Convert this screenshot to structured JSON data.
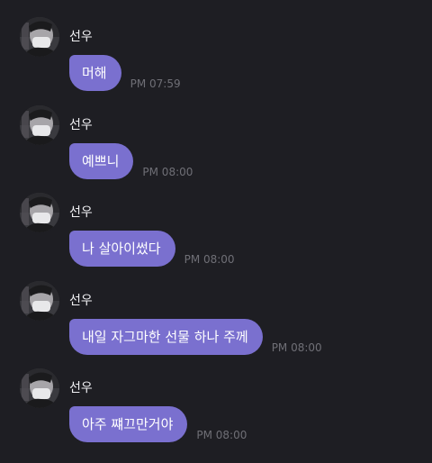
{
  "messages": [
    {
      "sender": "선우",
      "text": "머해",
      "time": "PM 07:59"
    },
    {
      "sender": "선우",
      "text": "예쁘니",
      "time": "PM 08:00"
    },
    {
      "sender": "선우",
      "text": "나 살아이썼다",
      "time": "PM 08:00"
    },
    {
      "sender": "선우",
      "text": "내일 자그마한 선물 하나 주께",
      "time": "PM 08:00"
    },
    {
      "sender": "선우",
      "text": "아주 쨰끄만거야",
      "time": "PM 08:00"
    }
  ],
  "colors": {
    "background": "#1e1e23",
    "bubble": "#7a70cf",
    "time_text": "#6f6f76",
    "sender_text": "#f1f1f4"
  },
  "icons": {
    "avatar": "profile-photo-avatar"
  }
}
